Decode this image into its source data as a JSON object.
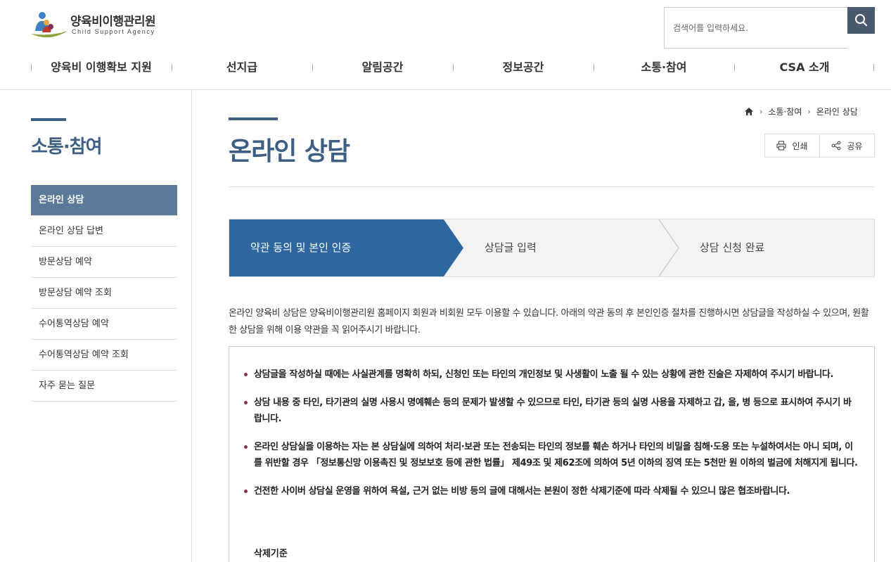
{
  "header": {
    "logo_title": "양육비이행관리원",
    "logo_sub": "Child Support Agency",
    "search_placeholder": "검색어를 입력하세요."
  },
  "gnb": [
    "양육비 이행확보 지원",
    "선지급",
    "알림공간",
    "정보공간",
    "소통·참여",
    "CSA 소개"
  ],
  "sidebar": {
    "title": "소통·참여",
    "items": [
      {
        "label": "온라인 상담",
        "active": true
      },
      {
        "label": "온라인 상담 답변"
      },
      {
        "label": "방문상담 예약"
      },
      {
        "label": "방문상담 예약 조회"
      },
      {
        "label": "수어통역상담 예약"
      },
      {
        "label": "수어통역상담 예약 조회"
      },
      {
        "label": "자주 묻는 질문"
      }
    ]
  },
  "breadcrumb": [
    "소통·참여",
    "온라인 상담"
  ],
  "page_title": "온라인 상담",
  "buttons": {
    "print": "인쇄",
    "share": "공유"
  },
  "steps": [
    "약관 동의 및 본인 인증",
    "상담글 입력",
    "상담 신청 완료"
  ],
  "intro": "온라인 양육비 상담은 양육비이행관리원 홈페이지 회원과 비회원 모두 이용할 수 있습니다. 아래의 약관 동의 후 본인인증 절차를 진행하시면 상담글을 작성하실 수 있으며, 원활한 상담을 위해 이용 약관을 꼭 읽어주시기 바랍니다.",
  "terms": [
    "상담글을 작성하실 때에는 사실관계를 명확히 하되, 신청인 또는 타인의 개인정보 및 사생활이 노출 될 수 있는 상황에 관한 진술은 자제하여 주시기 바랍니다.",
    "상담 내용 중 타인, 타기관의 실명 사용시 명예훼손 등의 문제가 발생할 수 있으므로 타인, 타기관 등의 실명 사용을 자제하고 갑, 을, 병 등으로 표시하여 주시기 바랍니다.",
    "온라인 상담실을 이용하는 자는 본 상담실에 의하여 처리·보관 또는 전송되는 타인의 정보를 훼손 하거나 타인의 비밀을 침해·도용 또는 누설하여서는 아니 되며, 이를 위반할 경우 「정보통신망 이용촉진 및 정보보호 등에 관한 법률」 제49조 및 제62조에 의하여 5년 이하의 징역 또는 5천만 원 이하의 벌금에 처해지게 됩니다.",
    "건전한 사이버 상담실 운영을 위하여 욕설, 근거 없는 비방 등의 글에 대해서는 본원이 정한 삭제기준에 따라 삭제될 수 있으니 많은 협조바랍니다."
  ],
  "terms_sub": "삭제기준",
  "colors": {
    "accent": "#3d5f84",
    "active_step": "#2e67a0",
    "sidebar_active": "#5b7a9a"
  }
}
